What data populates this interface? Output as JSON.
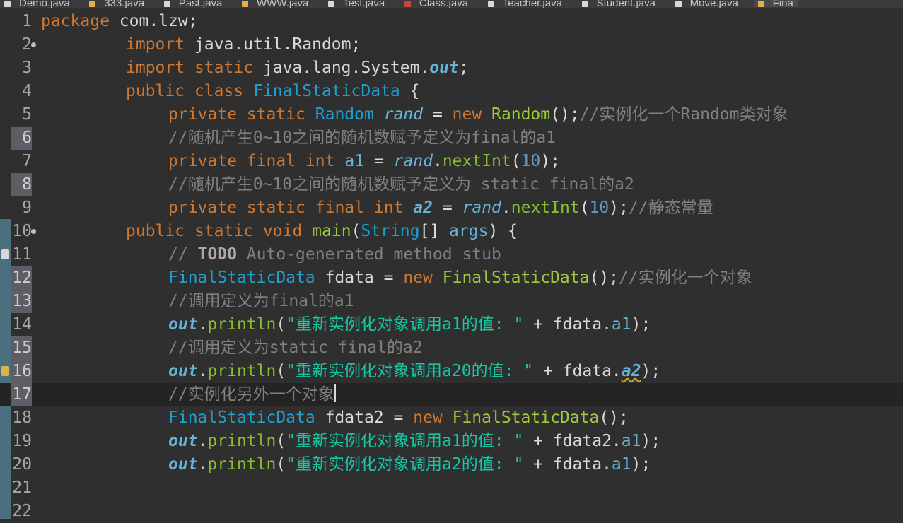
{
  "tabs": [
    {
      "label": "Demo.java",
      "icon": "java-file-icon"
    },
    {
      "label": "333.java",
      "icon": "java-file-icon-warning"
    },
    {
      "label": "Past.java",
      "icon": "java-file-icon"
    },
    {
      "label": "WWW.java",
      "icon": "java-file-icon-warning"
    },
    {
      "label": "Test.java",
      "icon": "java-file-icon"
    },
    {
      "label": "Class.java",
      "icon": "java-file-icon-error"
    },
    {
      "label": "Teacher.java",
      "icon": "java-file-icon"
    },
    {
      "label": "Student.java",
      "icon": "java-file-icon"
    },
    {
      "label": "Move.java",
      "icon": "java-file-icon"
    },
    {
      "label": "Fina",
      "icon": "java-file-icon-warning"
    }
  ],
  "lines": [
    {
      "n": "1"
    },
    {
      "n": "2"
    },
    {
      "n": "3"
    },
    {
      "n": "4"
    },
    {
      "n": "5"
    },
    {
      "n": "6"
    },
    {
      "n": "7"
    },
    {
      "n": "8"
    },
    {
      "n": "9"
    },
    {
      "n": "10"
    },
    {
      "n": "11"
    },
    {
      "n": "12"
    },
    {
      "n": "13"
    },
    {
      "n": "14"
    },
    {
      "n": "15"
    },
    {
      "n": "16"
    },
    {
      "n": "17"
    },
    {
      "n": "18"
    },
    {
      "n": "19"
    },
    {
      "n": "20"
    },
    {
      "n": "21"
    },
    {
      "n": "22"
    }
  ],
  "code": {
    "l1": {
      "kw": "package",
      "rest": " com.lzw;"
    },
    "l2": {
      "kw": "import",
      "rest": " java.util.Random;"
    },
    "l3": {
      "kw1": "import",
      "kw2": "static",
      "rest": " java.lang.System.",
      "fld": "out",
      "end": ";"
    },
    "l4": {
      "kw1": "public",
      "kw2": "class",
      "cls": "FinalStaticData",
      "end": " {"
    },
    "l5": {
      "kw1": "private",
      "kw2": "static",
      "cls": "Random",
      "fld": "rand",
      "eq": " = ",
      "kw3": "new",
      "cls2": "Random",
      "end": "();",
      "cm": "//实例化一个Random类对象"
    },
    "l6": {
      "cm": "//随机产生0~10之间的随机数赋予定义为final的a1"
    },
    "l7": {
      "kw1": "private",
      "kw2": "final",
      "kw3": "int",
      "fld": "a1",
      "eq": " = ",
      "sfld": "rand",
      "dot": ".",
      "mth": "nextInt",
      "op": "(",
      "num": "10",
      "end": ");"
    },
    "l8": {
      "cm": "//随机产生0~10之间的随机数赋予定义为 static final的a2"
    },
    "l9": {
      "kw1": "private",
      "kw2": "static",
      "kw3": "final",
      "kw4": "int",
      "fld": "a2",
      "eq": " = ",
      "sfld": "rand",
      "dot": ".",
      "mth": "nextInt",
      "op": "(",
      "num": "10",
      "end": ");",
      "cm": "//静态常量"
    },
    "l10": {
      "kw1": "public",
      "kw2": "static",
      "kw3": "void",
      "mth": "main",
      "op": "(",
      "cls": "String",
      "mid": "[] ",
      "arg": "args",
      "end": ") {"
    },
    "l11": {
      "cm1": "// ",
      "todo": "TODO",
      "cm2": " Auto-generated method stub"
    },
    "l12": {
      "cls": "FinalStaticData",
      "var": " fdata = ",
      "kw": "new",
      "cls2": "FinalStaticData",
      "end": "();",
      "cm": "//实例化一个对象"
    },
    "l13": {
      "cm": "//调用定义为final的a1"
    },
    "l14": {
      "sfld": "out",
      "dot": ".",
      "mth": "println",
      "op": "(",
      "str": "\"重新实例化对象调用a1的值: \"",
      "mid": " + fdata.",
      "fld": "a1",
      "end": ");"
    },
    "l15": {
      "cm": "//调用定义为static final的a2"
    },
    "l16": {
      "sfld": "out",
      "dot": ".",
      "mth": "println",
      "op": "(",
      "str": "\"重新实例化对象调用a20的值: \"",
      "mid": " + fdata.",
      "fld": "a2",
      "end": ");"
    },
    "l17": {
      "cm": "//实例化另外一个对象"
    },
    "l18": {
      "cls": "FinalStaticData",
      "var": " fdata2 = ",
      "kw": "new",
      "cls2": "FinalStaticData",
      "end": "();"
    },
    "l19": {
      "sfld": "out",
      "dot": ".",
      "mth": "println",
      "op": "(",
      "str": "\"重新实例化对象调用a1的值: \"",
      "mid": " + fdata2.",
      "fld": "a1",
      "end": ");"
    },
    "l20": {
      "sfld": "out",
      "dot": ".",
      "mth": "println",
      "op": "(",
      "str": "\"重新实例化对象调用a2的值: \"",
      "mid": " + fdata.",
      "fld": "a1",
      "end": ");"
    }
  },
  "colors": {
    "background": "#2f2f2f",
    "keyword": "#cc7832",
    "class": "#1f9fd0",
    "field": "#66b3d6",
    "method": "#9ecb3e",
    "string": "#17c6a3",
    "number": "#6897bb",
    "comment": "#808080"
  }
}
